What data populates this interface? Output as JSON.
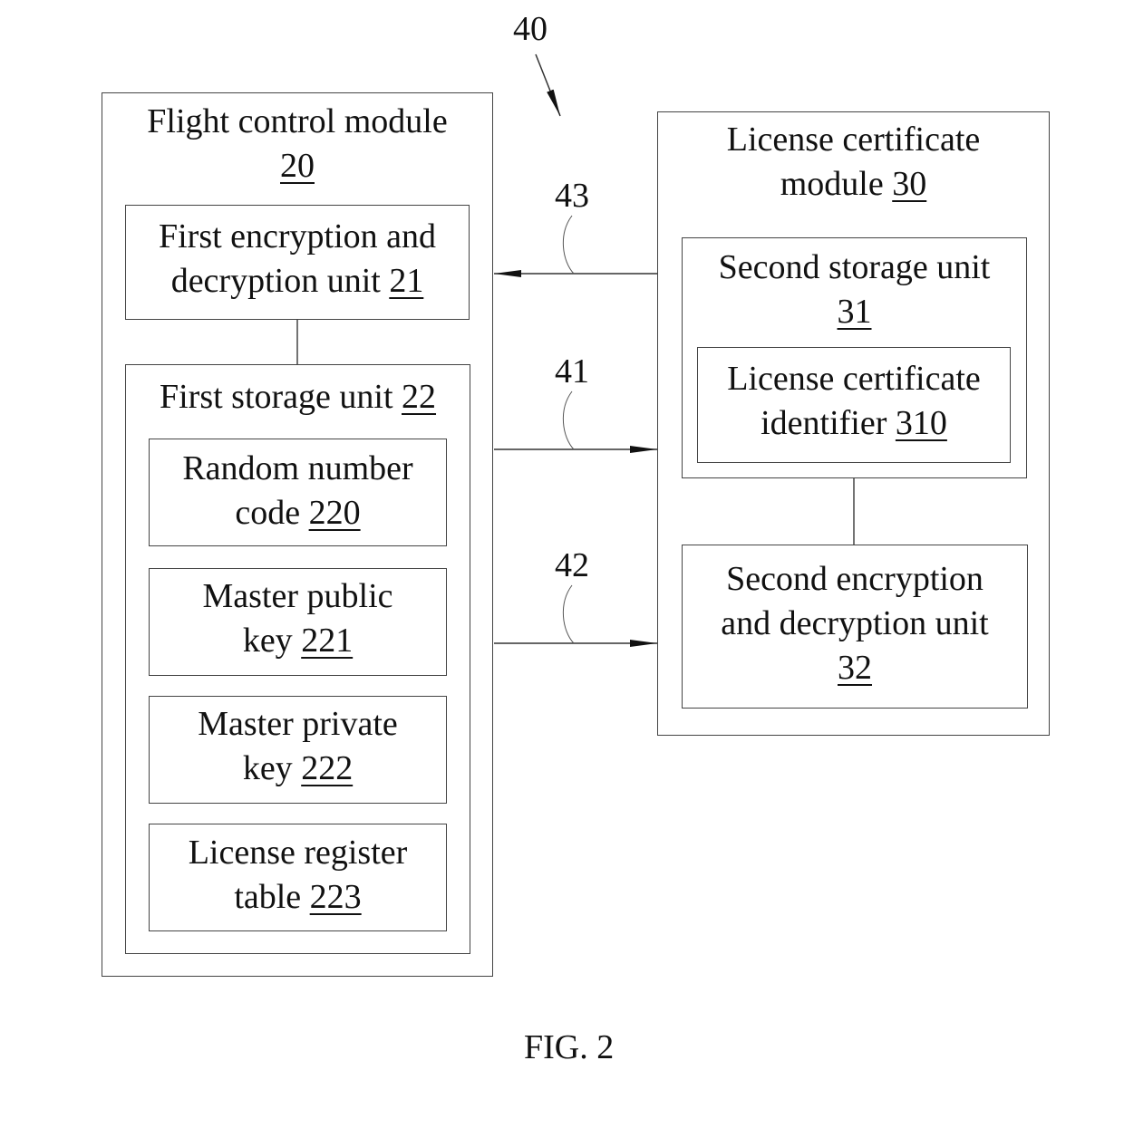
{
  "figure": {
    "ref": "40",
    "caption": "FIG. 2"
  },
  "flight_module": {
    "title": "Flight control module",
    "ref": "20",
    "enc_unit": {
      "line1": "First encryption and",
      "line2": "decryption unit",
      "ref": "21"
    },
    "storage": {
      "title": "First storage unit",
      "ref": "22",
      "items": [
        {
          "line1": "Random number",
          "line2": "code",
          "ref": "220"
        },
        {
          "line1": "Master public",
          "line2": "key",
          "ref": "221"
        },
        {
          "line1": "Master private",
          "line2": "key",
          "ref": "222"
        },
        {
          "line1": "License register",
          "line2": "table",
          "ref": "223"
        }
      ]
    }
  },
  "license_module": {
    "line1": "License certificate",
    "line2": "module",
    "ref": "30",
    "storage": {
      "title": "Second storage unit",
      "ref": "31",
      "identifier": {
        "line1": "License certificate",
        "line2": "identifier",
        "ref": "310"
      }
    },
    "enc_unit": {
      "line1": "Second encryption",
      "line2": "and decryption unit",
      "ref": "32"
    }
  },
  "connections": [
    {
      "ref": "43",
      "from": "license_module",
      "to": "flight_module.enc_unit"
    },
    {
      "ref": "41",
      "from": "flight_module.storage",
      "to": "license_module.storage"
    },
    {
      "ref": "42",
      "from": "flight_module.storage",
      "to": "license_module.enc_unit"
    }
  ]
}
